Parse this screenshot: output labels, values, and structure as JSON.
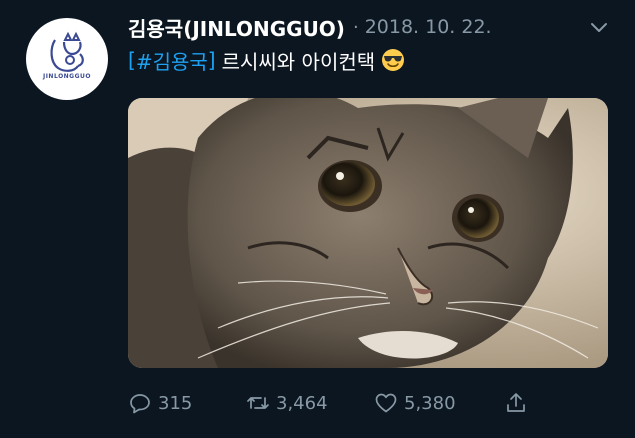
{
  "tweet": {
    "display_name": "김용국(JINLONGGUO)",
    "separator": "·",
    "timestamp": "2018. 10. 22.",
    "text": {
      "bracket_open": "[",
      "hashtag": "#김용국",
      "bracket_close": "]",
      "body": "르시씨와 아이컨택"
    },
    "emoji": "smiling-face-with-sunglasses",
    "avatar_logo_text": "JINLONGGUO",
    "media_description_icon": "cat-photo",
    "actions": {
      "replies": "315",
      "retweets": "3,464",
      "likes": "5,380"
    }
  },
  "colors": {
    "background": "#0b1620",
    "secondary_text": "#8899a6",
    "link": "#1da1f2"
  }
}
